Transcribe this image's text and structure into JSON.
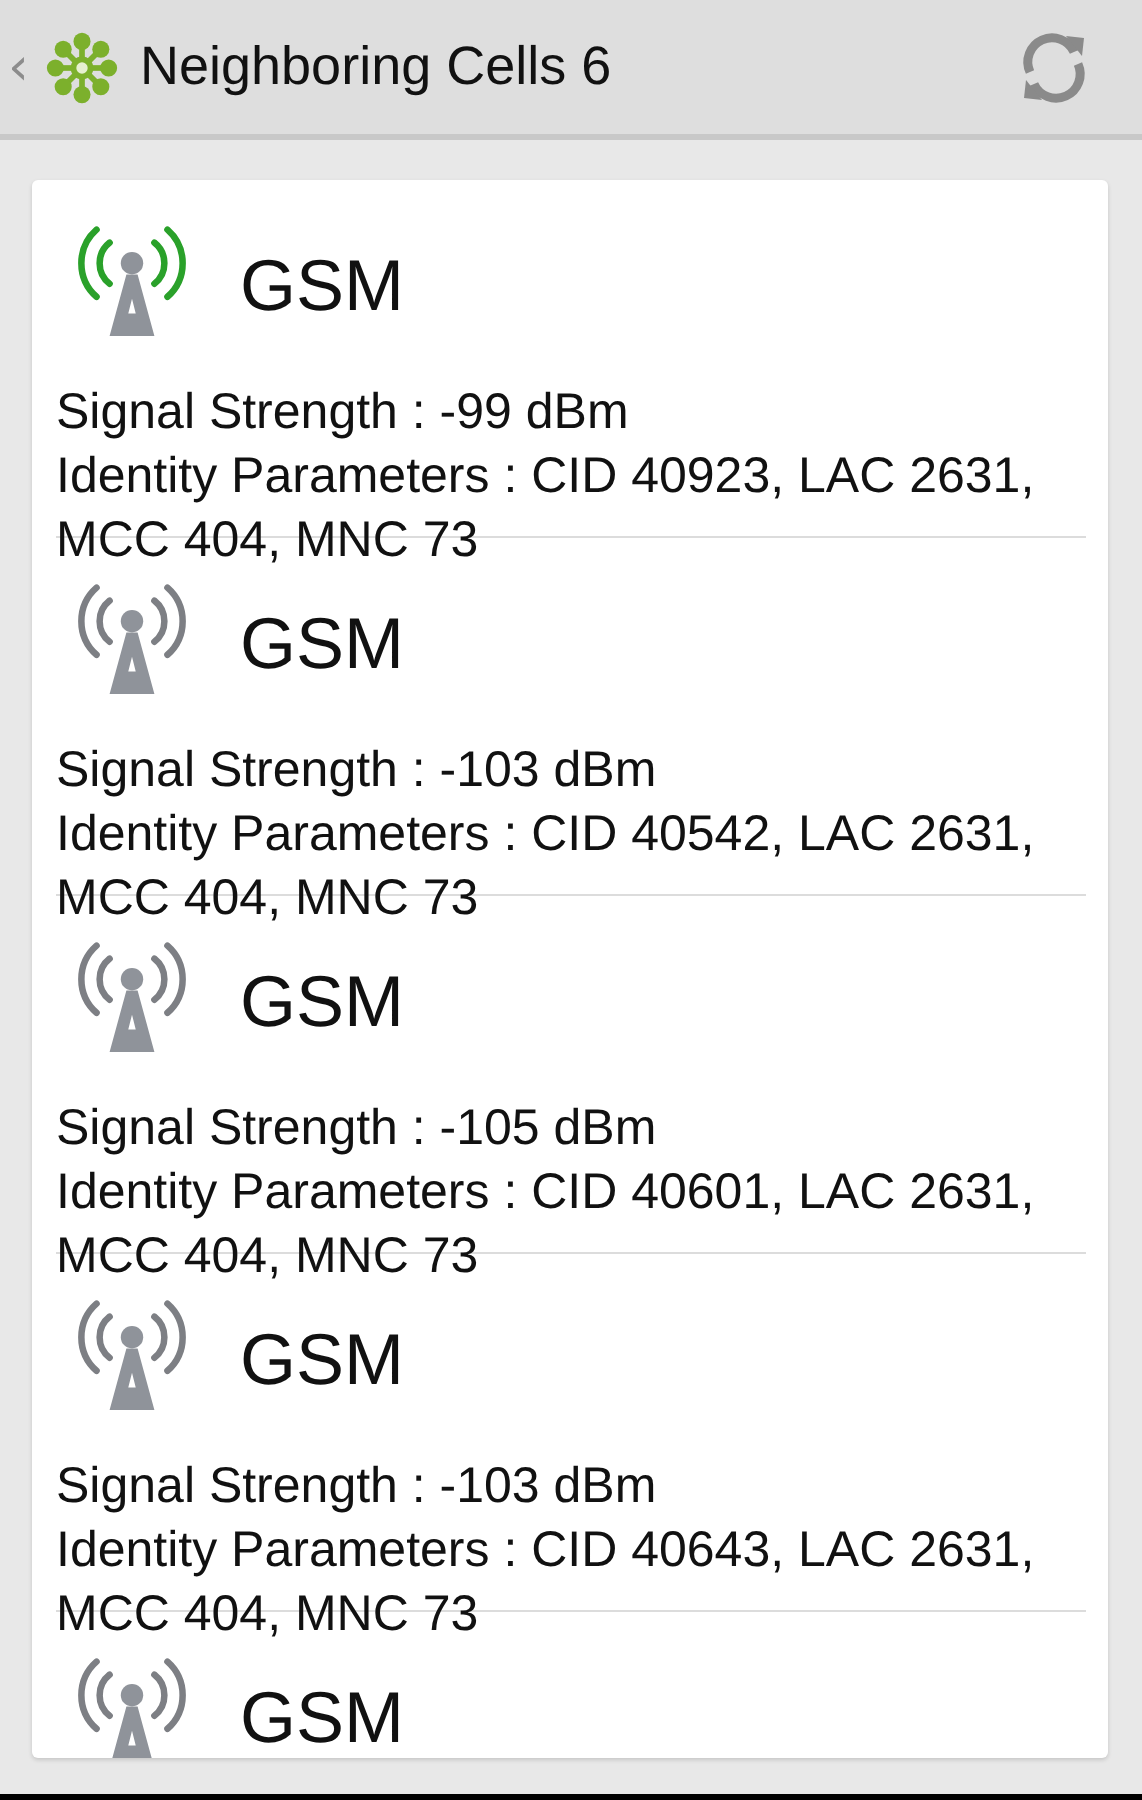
{
  "action_bar": {
    "back": "‹",
    "title": "Neighboring Cells 6"
  },
  "cells": [
    {
      "type": "GSM",
      "color": "#2aa12a",
      "signal": "Signal Strength : -99 dBm",
      "identity": "Identity Parameters : CID 40923, LAC 2631, MCC 404, MNC 73"
    },
    {
      "type": "GSM",
      "color": "#7d7f84",
      "signal": "Signal Strength : -103 dBm",
      "identity": "Identity Parameters : CID 40542, LAC 2631, MCC 404, MNC 73"
    },
    {
      "type": "GSM",
      "color": "#7d7f84",
      "signal": "Signal Strength : -105 dBm",
      "identity": "Identity Parameters : CID 40601, LAC 2631, MCC 404, MNC 73"
    },
    {
      "type": "GSM",
      "color": "#7d7f84",
      "signal": "Signal Strength : -103 dBm",
      "identity": "Identity Parameters : CID 40643, LAC 2631, MCC 404, MNC 73"
    },
    {
      "type": "GSM",
      "color": "#7d7f84"
    }
  ]
}
